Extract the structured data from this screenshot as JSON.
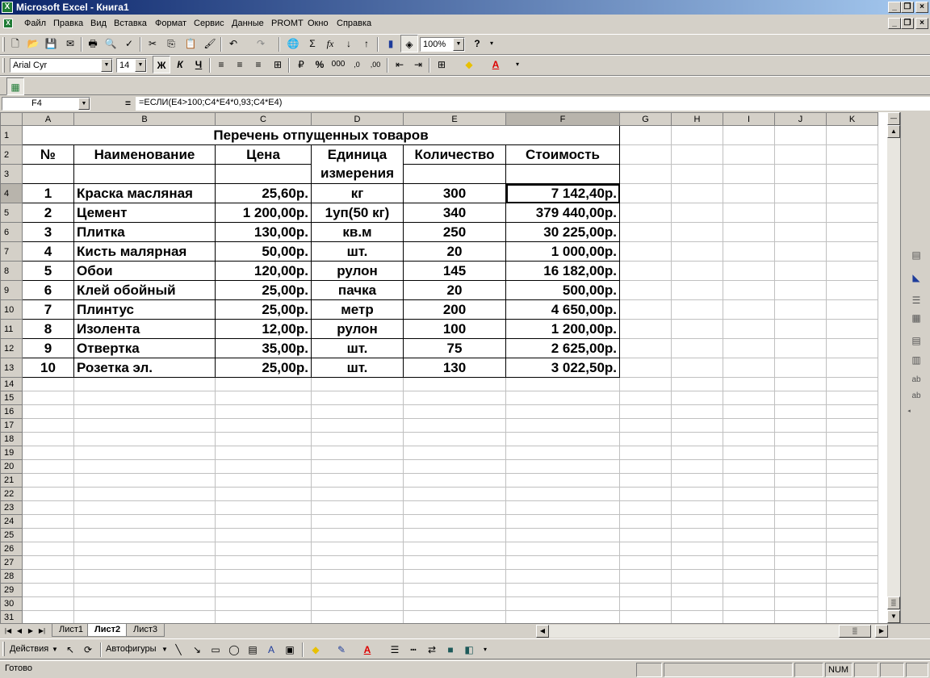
{
  "window": {
    "title": "Microsoft Excel - Книга1"
  },
  "menu": [
    "Файл",
    "Правка",
    "Вид",
    "Вставка",
    "Формат",
    "Сервис",
    "Данные",
    "PROMT",
    "Окно",
    "Справка"
  ],
  "toolbar": {
    "zoom": "100%",
    "font_name": "Arial Cyr",
    "font_size": "14",
    "bold_label": "Ж",
    "italic_label": "К",
    "underline_label": "Ч",
    "percent_label": "%",
    "thousands_label": "000",
    "sum_label": "Σ",
    "fx_label": "fx"
  },
  "formula_bar": {
    "name_box": "F4",
    "equals": "=",
    "formula": "=ЕСЛИ(E4>100;C4*E4*0,93;C4*E4)"
  },
  "columns": [
    "A",
    "B",
    "C",
    "D",
    "E",
    "F",
    "G",
    "H",
    "I",
    "J",
    "K"
  ],
  "table": {
    "title": "Перечень отпущенных товаров",
    "headers": {
      "num": "№",
      "name": "Наименование",
      "price": "Цена",
      "unit_line1": "Единица",
      "unit_line2": "измерения",
      "qty": "Количество",
      "cost": "Стоимость"
    },
    "rows": [
      {
        "n": "1",
        "name": "Краска масляная",
        "price": "25,60р.",
        "unit": "кг",
        "qty": "300",
        "cost": "7 142,40р."
      },
      {
        "n": "2",
        "name": "Цемент",
        "price": "1 200,00р.",
        "unit": "1уп(50 кг)",
        "qty": "340",
        "cost": "379 440,00р."
      },
      {
        "n": "3",
        "name": "Плитка",
        "price": "130,00р.",
        "unit": "кв.м",
        "qty": "250",
        "cost": "30 225,00р."
      },
      {
        "n": "4",
        "name": "Кисть малярная",
        "price": "50,00р.",
        "unit": "шт.",
        "qty": "20",
        "cost": "1 000,00р."
      },
      {
        "n": "5",
        "name": "Обои",
        "price": "120,00р.",
        "unit": "рулон",
        "qty": "145",
        "cost": "16 182,00р."
      },
      {
        "n": "6",
        "name": "Клей обойный",
        "price": "25,00р.",
        "unit": "пачка",
        "qty": "20",
        "cost": "500,00р."
      },
      {
        "n": "7",
        "name": "Плинтус",
        "price": "25,00р.",
        "unit": "метр",
        "qty": "200",
        "cost": "4 650,00р."
      },
      {
        "n": "8",
        "name": "Изолента",
        "price": "12,00р.",
        "unit": "рулон",
        "qty": "100",
        "cost": "1 200,00р."
      },
      {
        "n": "9",
        "name": "Отвертка",
        "price": "35,00р.",
        "unit": "шт.",
        "qty": "75",
        "cost": "2 625,00р."
      },
      {
        "n": "10",
        "name": "Розетка эл.",
        "price": "25,00р.",
        "unit": "шт.",
        "qty": "130",
        "cost": "3 022,50р."
      }
    ]
  },
  "row_numbers": [
    "1",
    "2",
    "3",
    "4",
    "5",
    "6",
    "7",
    "8",
    "9",
    "10",
    "11",
    "12",
    "13",
    "14",
    "15",
    "16",
    "17",
    "18",
    "19",
    "20",
    "21",
    "22",
    "23",
    "24",
    "25",
    "26",
    "27",
    "28",
    "29",
    "30",
    "31"
  ],
  "sheet_tabs": [
    "Лист1",
    "Лист2",
    "Лист3"
  ],
  "active_tab": "Лист2",
  "drawing": {
    "actions": "Действия",
    "autoshapes": "Автофигуры"
  },
  "status": {
    "ready": "Готово",
    "num": "NUM"
  },
  "colors": {
    "title_start": "#0a246a",
    "title_end": "#a6caf0",
    "chrome": "#d4d0c8",
    "excel_green": "#1e7b34"
  }
}
